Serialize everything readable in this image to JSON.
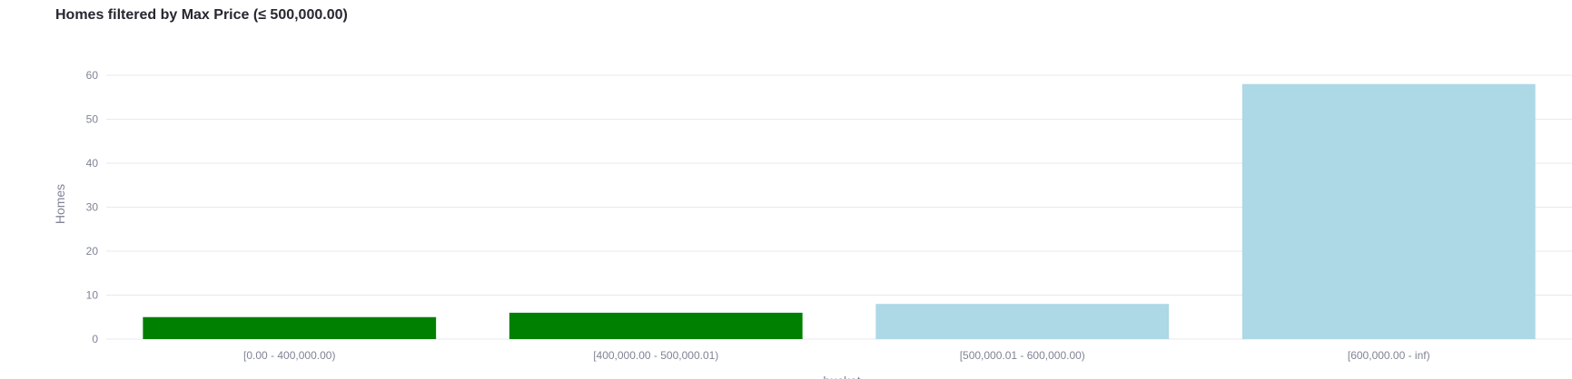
{
  "chart_data": {
    "type": "bar",
    "title": "Homes filtered by Max Price (≤ 500,000.00)",
    "xlabel": "bucket",
    "ylabel": "Homes",
    "categories": [
      "[0.00 - 400,000.00)",
      "[400,000.00 - 500,000.01)",
      "[500,000.01 - 600,000.00)",
      "[600,000.00 - inf)"
    ],
    "values": [
      5,
      6,
      8,
      58
    ],
    "bar_colors": [
      "#008000",
      "#008000",
      "#add8e6",
      "#add8e6"
    ],
    "ylim": [
      0,
      60
    ],
    "yticks": [
      0,
      10,
      20,
      30,
      40,
      50,
      60
    ],
    "grid": true,
    "legend": "none"
  }
}
